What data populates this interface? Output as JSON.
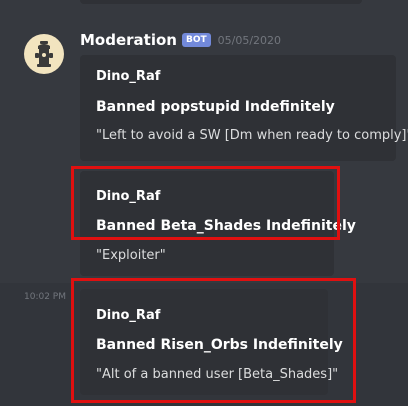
{
  "message": {
    "author": "Moderation",
    "bot_tag": "BOT",
    "date": "05/05/2020",
    "avatar_icon": "fire-hydrant-icon"
  },
  "embeds": [
    {
      "author": "Dino_Raf",
      "title": "Banned popstupid Indefinitely",
      "description": "\"Left to avoid a SW [Dm when ready to comply]\""
    },
    {
      "author": "Dino_Raf",
      "title": "Banned Beta_Shades Indefinitely",
      "description": "\"Exploiter\""
    },
    {
      "author": "Dino_Raf",
      "title": "Banned Risen_Orbs Indefinitely",
      "description": "\"Alt of a banned user [Beta_Shades]\""
    }
  ],
  "hover_timestamp": "10:02 PM",
  "colors": {
    "background": "#36393f",
    "embed_background": "#2f3136",
    "bot_tag": "#7289da",
    "annotation": "#e01010"
  }
}
